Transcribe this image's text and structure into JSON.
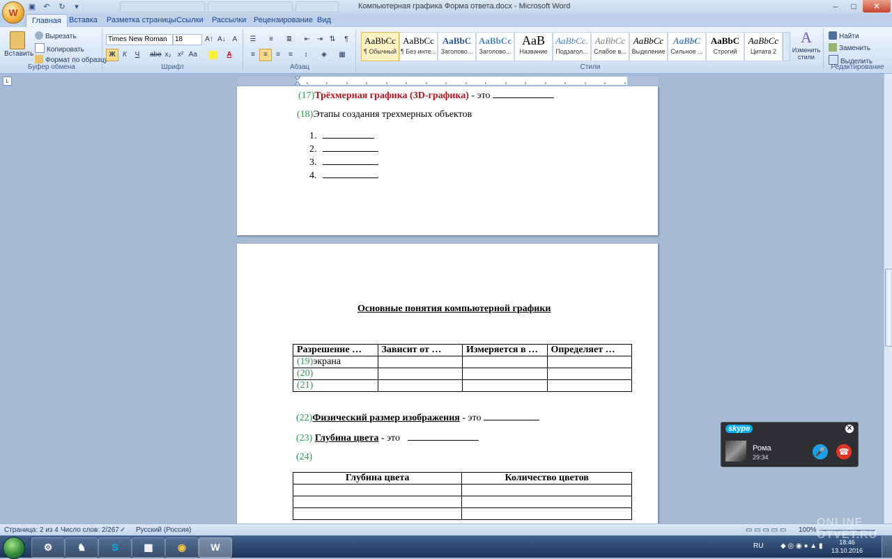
{
  "window": {
    "title": "Компьютерная графика Форма ответа.docx - Microsoft Word",
    "office_button": "W"
  },
  "quick_access": {
    "save": "▣",
    "undo": "↶",
    "redo": "↻",
    "customize": "▾"
  },
  "window_buttons": {
    "minimize": "–",
    "maximize": "□",
    "close": "✕"
  },
  "ribbon_tabs": [
    "Главная",
    "Вставка",
    "Разметка страницы",
    "Ссылки",
    "Рассылки",
    "Рецензирование",
    "Вид"
  ],
  "clipboard": {
    "paste": "Вставить",
    "cut": "Вырезать",
    "copy": "Копировать",
    "format_painter": "Формат по образцу",
    "label": "Буфер обмена"
  },
  "font": {
    "name": "Times New Roman",
    "size": "18",
    "label": "Шрифт",
    "bold": "Ж",
    "italic": "К",
    "underline": "Ч",
    "strike": "abe",
    "sub": "x₂",
    "sup": "x²",
    "case": "Aa",
    "grow": "A↑",
    "shrink": "A↓",
    "clear": "A"
  },
  "paragraph": {
    "label": "Абзац",
    "pilcrow": "¶"
  },
  "styles": {
    "label": "Стили",
    "items": [
      {
        "sample": "AaBbCc",
        "name": "¶ Обычный"
      },
      {
        "sample": "AaBbCc",
        "name": "¶ Без инте..."
      },
      {
        "sample": "AaBbC",
        "name": "Заголово..."
      },
      {
        "sample": "AaBbCc",
        "name": "Заголово..."
      },
      {
        "sample": "AaB",
        "name": "Название"
      },
      {
        "sample": "AaBbCc.",
        "name": "Подзагол..."
      },
      {
        "sample": "AaBbCc",
        "name": "Слабое в..."
      },
      {
        "sample": "AaBbCc",
        "name": "Выделение"
      },
      {
        "sample": "AaBbC",
        "name": "Сильное ..."
      },
      {
        "sample": "AaBbC",
        "name": "Строгий"
      },
      {
        "sample": "AaBbCc",
        "name": "Цитата 2"
      }
    ],
    "change_styles": "Изменить стили"
  },
  "editing": {
    "find": "Найти",
    "replace": "Заменить",
    "select": "Выделить",
    "label": "Редактирование"
  },
  "ruler": {
    "corner": "L"
  },
  "page1": {
    "item17": {
      "num": "(17)",
      "term": "Трёхмерная графика (3D-графика)",
      "rest": " - это "
    },
    "item18": {
      "num": "(18)",
      "text": "Этапы создания трехмерных объектов"
    },
    "list_numbers": [
      "1.",
      "2.",
      "3.",
      "4."
    ]
  },
  "page2": {
    "heading": "Основные понятия компьютерной графики",
    "table1": {
      "headers": [
        "Разрешение …",
        "Зависит от …",
        "Измеряется в …",
        "Определяет …"
      ],
      "rows": [
        {
          "num": "(19)",
          "text": "экрана"
        },
        {
          "num": "(20)",
          "text": ""
        },
        {
          "num": "(21)",
          "text": ""
        }
      ]
    },
    "item22": {
      "num": "(22)",
      "term": "Физический размер изображения",
      "rest": "  - это "
    },
    "item23": {
      "num": "(23)",
      "term": "Глубина цвета",
      "rest": " - это "
    },
    "item24": {
      "num": "(24)"
    },
    "table2": {
      "headers": [
        "Глубина цвета",
        "Количество цветов"
      ]
    }
  },
  "status": {
    "page": "Страница: 2 из 4",
    "words": "Число слов: 2/267",
    "language": "Русский (Россия)",
    "zoom": "100%"
  },
  "skype": {
    "logo": "skype",
    "contact": "Рома",
    "duration": "29:34",
    "close": "✕",
    "mic": "🎤",
    "hangup": "☎"
  },
  "taskbar": {
    "lang": "RU",
    "time": "18:46",
    "date": "13.10.2016",
    "apps": [
      "S",
      "▦",
      "◉",
      "W"
    ]
  },
  "watermark": "ONLINE OTVET.RU"
}
